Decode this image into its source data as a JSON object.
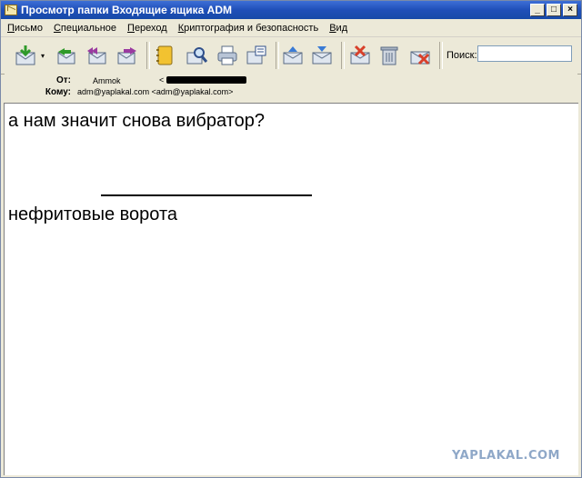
{
  "window": {
    "title": "Просмотр папки Входящие ящика ADM",
    "controls": [
      "_",
      "□",
      "×"
    ]
  },
  "menu": [
    {
      "acc": "П",
      "rest": "исьмо"
    },
    {
      "acc": "С",
      "rest": "пециальное"
    },
    {
      "acc": "П",
      "rest": "ереход"
    },
    {
      "acc": "К",
      "rest": "риптография и безопасность"
    },
    {
      "acc": "В",
      "rest": "ид"
    }
  ],
  "toolbar": {
    "icons": [
      "get-mail-icon",
      "reply-icon",
      "reply-all-icon",
      "forward-icon",
      "address-book-icon",
      "find-icon",
      "print-icon",
      "properties-icon",
      "move-up-icon",
      "move-down-icon",
      "mark-spam-icon",
      "trash-icon",
      "delete-icon"
    ],
    "search_label": "Поиск:",
    "search_value": ""
  },
  "header": {
    "from_label": "От:",
    "from_name": "Ammok",
    "from_bracket": "<",
    "to_label": "Кому:",
    "to_value": "adm@yaplakal.com <adm@yaplakal.com>"
  },
  "message": {
    "line1": "а нам значит снова вибратор?",
    "line2": "нефритовые ворота"
  },
  "watermark": "YAPLAKAL.COM",
  "colors": {
    "title_bar": "#1f4fb8",
    "chrome": "#ece9d8",
    "watermark": "#8fa8c8"
  }
}
